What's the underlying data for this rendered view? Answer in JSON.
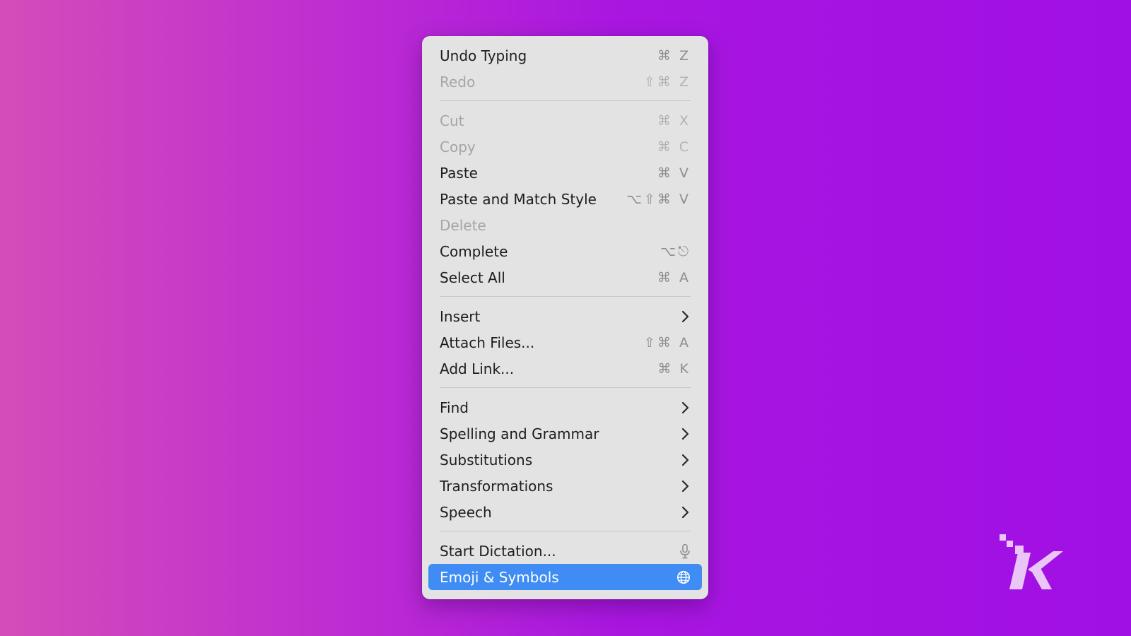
{
  "menu": {
    "groups": [
      [
        {
          "label": "Undo Typing",
          "shortcut": "⌘ Z",
          "disabled": false
        },
        {
          "label": "Redo",
          "shortcut": "⇧⌘ Z",
          "disabled": true
        }
      ],
      [
        {
          "label": "Cut",
          "shortcut": "⌘ X",
          "disabled": true
        },
        {
          "label": "Copy",
          "shortcut": "⌘ C",
          "disabled": true
        },
        {
          "label": "Paste",
          "shortcut": "⌘ V",
          "disabled": false
        },
        {
          "label": "Paste and Match Style",
          "shortcut": "⌥⇧⌘ V",
          "disabled": false
        },
        {
          "label": "Delete",
          "shortcut": "",
          "disabled": true
        },
        {
          "label": "Complete",
          "shortcut": "⌥⎋",
          "disabled": false
        },
        {
          "label": "Select All",
          "shortcut": "⌘ A",
          "disabled": false
        }
      ],
      [
        {
          "label": "Insert",
          "submenu": true,
          "icon": "chevron-right-icon"
        },
        {
          "label": "Attach Files...",
          "shortcut": "⇧⌘ A",
          "disabled": false
        },
        {
          "label": "Add Link...",
          "shortcut": "⌘ K",
          "disabled": false
        }
      ],
      [
        {
          "label": "Find",
          "submenu": true,
          "icon": "chevron-right-icon"
        },
        {
          "label": "Spelling and Grammar",
          "submenu": true,
          "icon": "chevron-right-icon"
        },
        {
          "label": "Substitutions",
          "submenu": true,
          "icon": "chevron-right-icon"
        },
        {
          "label": "Transformations",
          "submenu": true,
          "icon": "chevron-right-icon"
        },
        {
          "label": "Speech",
          "submenu": true,
          "icon": "chevron-right-icon"
        }
      ],
      [
        {
          "label": "Start Dictation...",
          "icon": "microphone-icon",
          "disabled": false
        },
        {
          "label": "Emoji & Symbols",
          "icon": "globe-icon",
          "selected": true
        }
      ]
    ]
  },
  "colors": {
    "selected_bg": "#3f8cf5",
    "menu_bg": "#e3e3e3",
    "gradient_left": "#d34db9",
    "gradient_right": "#a00fe4",
    "logo": "#e9c6f7"
  },
  "logo": {
    "icon": "k-brand-logo-icon"
  }
}
